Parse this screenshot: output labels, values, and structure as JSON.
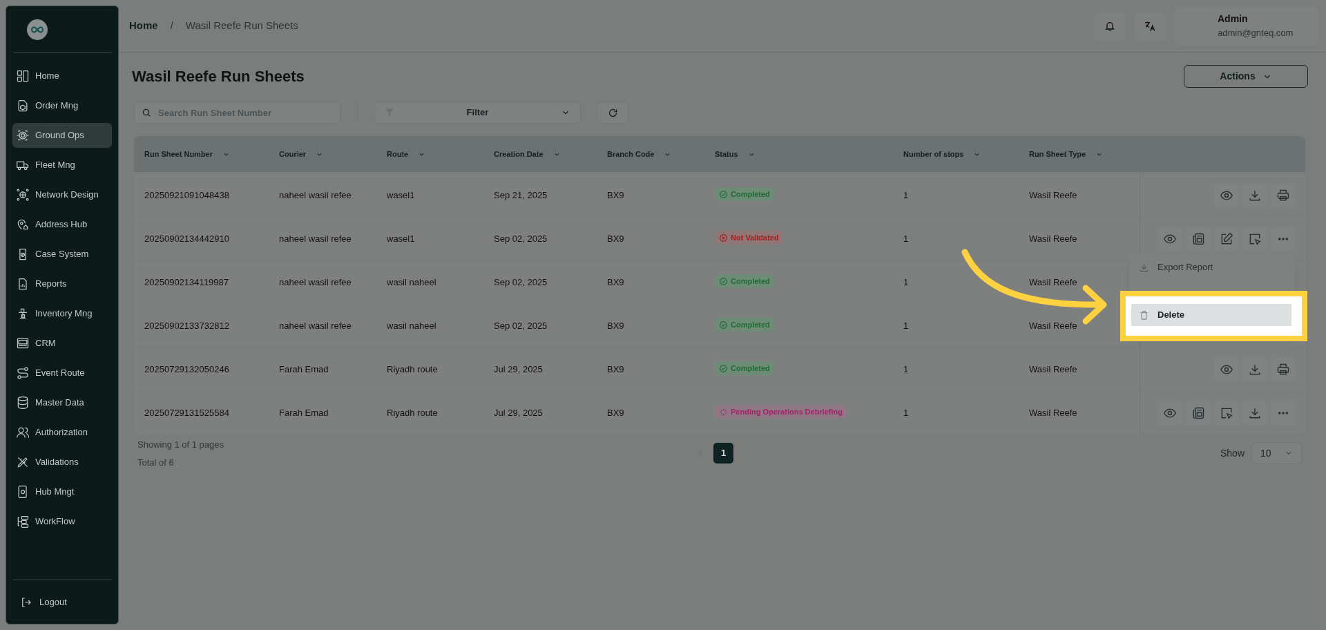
{
  "sidebar": {
    "items": [
      {
        "label": "Home",
        "selected": false
      },
      {
        "label": "Order Mng",
        "selected": false
      },
      {
        "label": "Ground Ops",
        "selected": true
      },
      {
        "label": "Fleet Mng",
        "selected": false
      },
      {
        "label": "Network Design",
        "selected": false
      },
      {
        "label": "Address Hub",
        "selected": false
      },
      {
        "label": "Case System",
        "selected": false
      },
      {
        "label": "Reports",
        "selected": false
      },
      {
        "label": "Inventory Mng",
        "selected": false
      },
      {
        "label": "CRM",
        "selected": false
      },
      {
        "label": "Event Route",
        "selected": false
      },
      {
        "label": "Master Data",
        "selected": false
      },
      {
        "label": "Authorization",
        "selected": false
      },
      {
        "label": "Validations",
        "selected": false
      },
      {
        "label": "Hub Mngt",
        "selected": false
      },
      {
        "label": "WorkFlow",
        "selected": false
      }
    ],
    "logout": "Logout"
  },
  "breadcrumb": [
    "Home",
    "/",
    "Wasil Reefe Run Sheets"
  ],
  "user": {
    "name": "Admin",
    "email": "admin@gnteq.com"
  },
  "page_title": "Wasil Reefe Run Sheets",
  "actions_button": "Actions",
  "search": {
    "placeholder": "Search Run Sheet Number"
  },
  "filter": "Filter",
  "table": {
    "columns": [
      "Run Sheet Number",
      "Courier",
      "Route",
      "Creation Date",
      "Branch Code",
      "Status",
      "Number of stops",
      "Run Sheet Type"
    ],
    "rows": [
      {
        "number": "20250921091048438",
        "courier": "naheel wasil refee",
        "route": "wasel1",
        "date": "Sep 21, 2025",
        "branch": "BX9",
        "status": {
          "label": "Completed",
          "kind": "completed"
        },
        "stops": "1",
        "type": "Wasil Reefe",
        "actions": [
          {
            "kind": "view"
          },
          {
            "kind": "download"
          },
          {
            "kind": "print"
          }
        ]
      },
      {
        "number": "20250902134442910",
        "courier": "naheel wasil refee",
        "route": "wasel1",
        "date": "Sep 02, 2025",
        "branch": "BX9",
        "status": {
          "label": "Not Validated",
          "kind": "not_validated"
        },
        "stops": "1",
        "type": "Wasil Reefe",
        "actions": [
          {
            "kind": "view"
          },
          {
            "kind": "report"
          },
          {
            "kind": "edit"
          },
          {
            "kind": "select"
          },
          {
            "kind": "more"
          }
        ]
      },
      {
        "number": "20250902134119987",
        "courier": "naheel wasil refee",
        "route": "wasil naheel",
        "date": "Sep 02, 2025",
        "branch": "BX9",
        "status": {
          "label": "Completed",
          "kind": "completed"
        },
        "stops": "1",
        "type": "Wasil Reefe"
      },
      {
        "number": "20250902133732812",
        "courier": "naheel wasil refee",
        "route": "wasil naheel",
        "date": "Sep 02, 2025",
        "branch": "BX9",
        "status": {
          "label": "Completed",
          "kind": "completed"
        },
        "stops": "1",
        "type": "Wasil Reefe"
      },
      {
        "number": "20250729132050246",
        "courier": "Farah Emad",
        "route": "Riyadh route",
        "date": "Jul 29, 2025",
        "branch": "BX9",
        "status": {
          "label": "Completed",
          "kind": "completed"
        },
        "stops": "1",
        "type": "Wasil Reefe",
        "actions": [
          {
            "kind": "view"
          },
          {
            "kind": "download"
          },
          {
            "kind": "print"
          }
        ]
      },
      {
        "number": "20250729131525584",
        "courier": "Farah Emad",
        "route": "Riyadh route",
        "date": "Jul 29, 2025",
        "branch": "BX9",
        "status": {
          "label": "Pending Operations Debriefing",
          "kind": "pending"
        },
        "stops": "1",
        "type": "Wasil Reefe",
        "actions": [
          {
            "kind": "view"
          },
          {
            "kind": "report"
          },
          {
            "kind": "select"
          },
          {
            "kind": "download"
          },
          {
            "kind": "more"
          }
        ]
      }
    ]
  },
  "pagination": {
    "showing": "Showing 1 of 1 pages",
    "total": "Total of 6",
    "pages": [
      {
        "label": "1",
        "selected": true
      }
    ],
    "show_label": "Show",
    "page_size": "10"
  },
  "row_menu": {
    "items": [
      {
        "label": "Export Report",
        "kind": "export",
        "highlighted": false
      },
      {
        "label": "Delete",
        "kind": "delete",
        "highlighted": true
      }
    ]
  }
}
